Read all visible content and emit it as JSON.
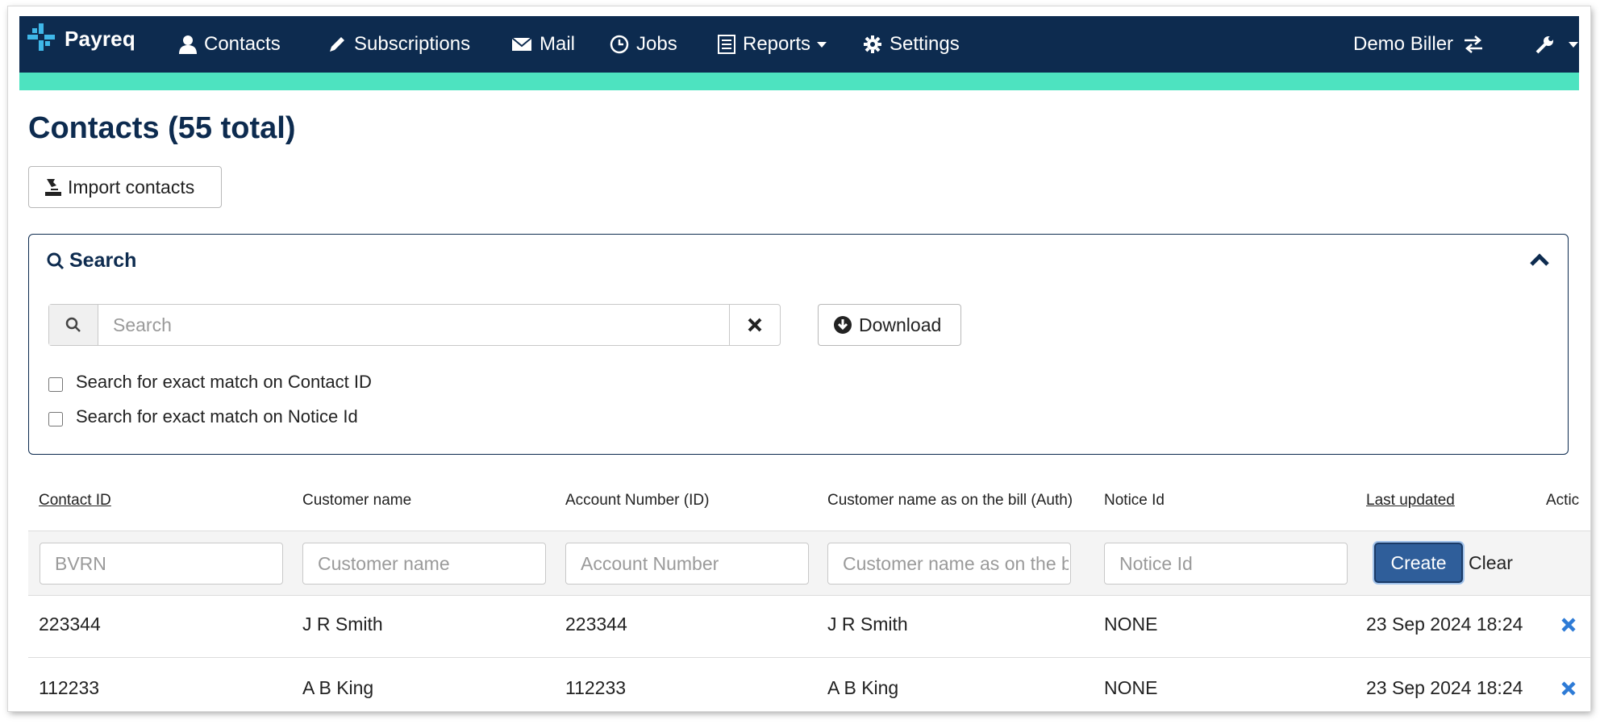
{
  "nav": {
    "brand": "Payreq",
    "items": [
      {
        "label": "Contacts",
        "icon": "user-icon"
      },
      {
        "label": "Subscriptions",
        "icon": "pencil-icon"
      },
      {
        "label": "Mail",
        "icon": "envelope-icon"
      },
      {
        "label": "Jobs",
        "icon": "clock-icon"
      },
      {
        "label": "Reports",
        "icon": "list-icon"
      },
      {
        "label": "Settings",
        "icon": "gear-icon"
      }
    ],
    "user": "Demo Biller"
  },
  "colors": {
    "navbar": "#0d2b4f",
    "accent": "#4de3c0",
    "primary_button": "#2f5e9a",
    "delete_icon": "#2e7bd6"
  },
  "page": {
    "title": "Contacts (55 total)",
    "import_label": "Import contacts"
  },
  "search": {
    "title": "Search",
    "placeholder": "Search",
    "download_label": "Download",
    "options": [
      "Search for exact match on Contact ID",
      "Search for exact match on Notice Id"
    ]
  },
  "table": {
    "headers": [
      "Contact ID",
      "Customer name",
      "Account Number (ID)",
      "Customer name as on the bill (Auth)",
      "Notice Id",
      "Last updated",
      "Actic"
    ],
    "filters": {
      "contact_id": "BVRN",
      "customer_name": "Customer name",
      "account_number": "Account Number",
      "customer_name_bill": "Customer name as on the bill",
      "notice_id": "Notice Id"
    },
    "create_label": "Create",
    "clear_label": "Clear",
    "rows": [
      {
        "contact_id": "223344",
        "customer_name": "J R Smith",
        "account_number": "223344",
        "name_on_bill": "J R Smith",
        "notice_id": "NONE",
        "last_updated": "23 Sep 2024 18:24"
      },
      {
        "contact_id": "112233",
        "customer_name": "A B King",
        "account_number": "112233",
        "name_on_bill": "A B King",
        "notice_id": "NONE",
        "last_updated": "23 Sep 2024 18:24"
      }
    ]
  }
}
